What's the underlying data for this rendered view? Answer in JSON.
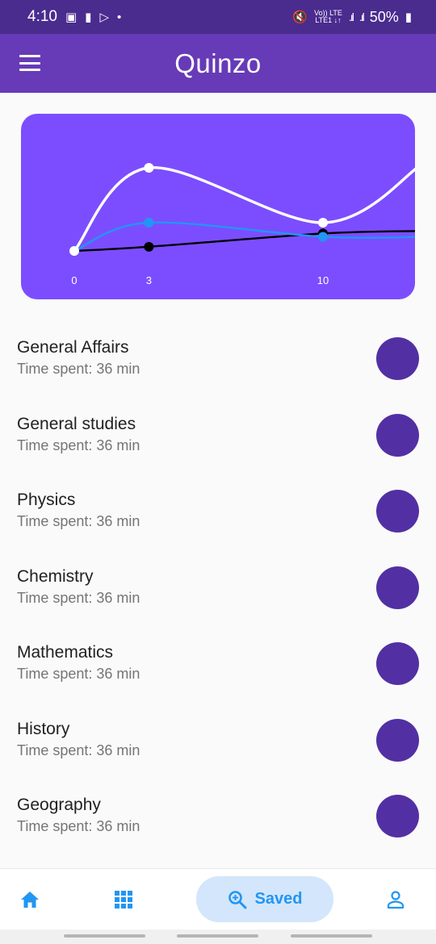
{
  "status_bar": {
    "time": "4:10",
    "network_top": "Vo)) LTE",
    "network_bottom": "LTE1 ↓↑",
    "battery": "50%"
  },
  "app_bar": {
    "title": "Quinzo"
  },
  "chart_data": {
    "type": "line",
    "x_ticks": [
      "0",
      "3",
      "10"
    ],
    "xlim": [
      0,
      14
    ],
    "series": [
      {
        "color": "#ffffff",
        "points": [
          [
            0,
            0
          ],
          [
            3,
            10
          ],
          [
            10,
            3.4
          ],
          [
            14,
            10.5
          ]
        ],
        "markers": [
          0,
          3,
          10
        ]
      },
      {
        "color": "#2196f3",
        "points": [
          [
            0,
            0
          ],
          [
            3,
            3.4
          ],
          [
            10,
            1.7
          ],
          [
            14,
            1.7
          ]
        ],
        "markers": [
          0,
          3,
          10
        ]
      },
      {
        "color": "#000000",
        "points": [
          [
            0,
            0
          ],
          [
            3,
            0.5
          ],
          [
            10,
            2.1
          ],
          [
            14,
            2.4
          ]
        ],
        "markers": [
          3,
          10
        ]
      }
    ],
    "grid": false,
    "legend": "none"
  },
  "subjects": [
    {
      "name": "General Affairs",
      "time": "Time spent: 36 min"
    },
    {
      "name": "General studies",
      "time": "Time spent: 36 min"
    },
    {
      "name": "Physics",
      "time": "Time spent: 36 min"
    },
    {
      "name": "Chemistry",
      "time": "Time spent: 36 min"
    },
    {
      "name": "Mathematics",
      "time": "Time spent: 36 min"
    },
    {
      "name": "History",
      "time": "Time spent: 36 min"
    },
    {
      "name": "Geography",
      "time": "Time spent: 36 min"
    }
  ],
  "bottom_nav": {
    "items": [
      {
        "icon": "home-icon"
      },
      {
        "icon": "apps-grid-icon"
      },
      {
        "icon": "zoom-in-icon",
        "label": "Saved"
      },
      {
        "icon": "person-icon"
      }
    ],
    "active_color": "#2196f3"
  },
  "colors": {
    "status_bar": "#4a2c8f",
    "app_bar": "#673ab7",
    "chart_bg": "#7c4dff",
    "circle": "#5230a3"
  }
}
